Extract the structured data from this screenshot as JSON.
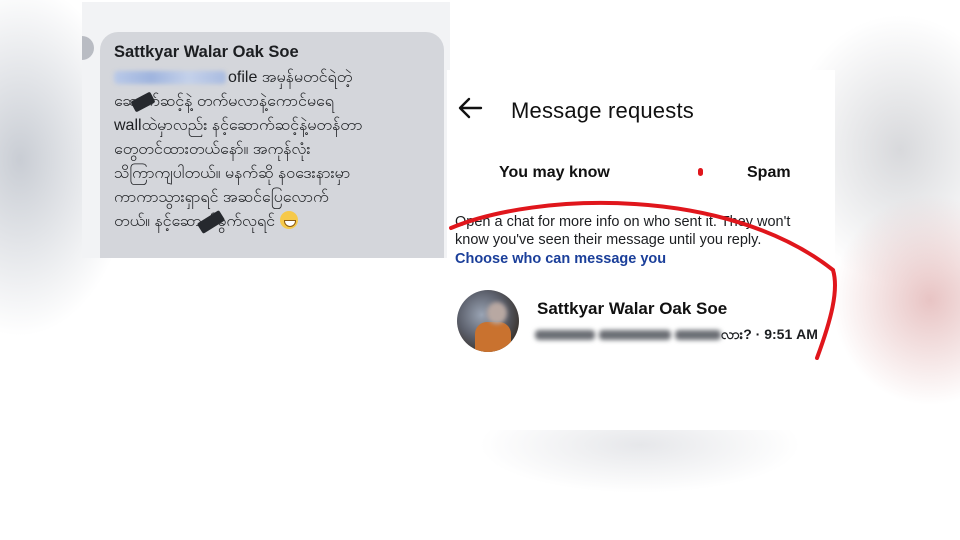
{
  "chat_bubble": {
    "sender": "Sattkyar Walar Oak Soe",
    "lines": [
      "ofile အမှန်မတင်ရဲတဲ့",
      "ဆောက်ဆင့်နဲ့ တက်မလာနဲ့ကောင်မရေ",
      "wallထဲမှာလည်း နင့်ဆောက်ဆင့်နဲ့မတန်တာ",
      "တွေတင်ထားတယ်နော်။ အကုန်လုံး",
      "သိကြာကျပါတယ်။ မနက်ဆို နဝဒေးနားမှာ",
      "ကာကာသွားရှာရင် အဆင်ပြေလောက်",
      "တယ်။ နင့်ဆောက်ခွက်လုရင်"
    ]
  },
  "requests_screen": {
    "title": "Message requests",
    "tabs": [
      "You may know",
      "Spam"
    ],
    "info_line1": "Open a chat for more info on who sent it. They won't",
    "info_line2": "know you've seen their message until you reply.",
    "link": "Choose who can message you",
    "request": {
      "name": "Sattkyar Walar Oak Soe",
      "preview_end": "လား? · 9:51 AM"
    }
  },
  "colors": {
    "bubble": "#d4d6db",
    "link": "#1b3f9a",
    "annotation": "#e0161c"
  },
  "icons": {
    "back": "arrow-left",
    "emoji": "grinning-face"
  }
}
